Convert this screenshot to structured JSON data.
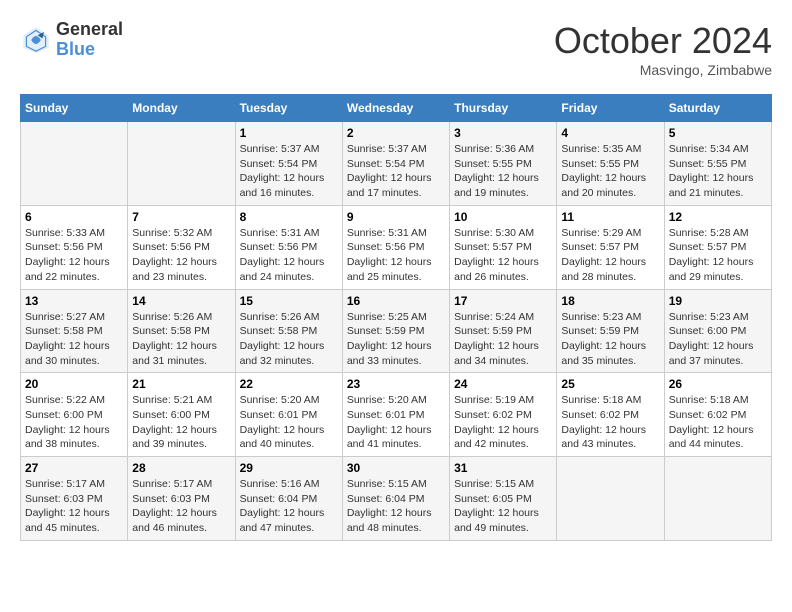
{
  "header": {
    "logo_line1": "General",
    "logo_line2": "Blue",
    "month": "October 2024",
    "location": "Masvingo, Zimbabwe"
  },
  "days_of_week": [
    "Sunday",
    "Monday",
    "Tuesday",
    "Wednesday",
    "Thursday",
    "Friday",
    "Saturday"
  ],
  "weeks": [
    [
      {
        "day": "",
        "empty": true
      },
      {
        "day": "",
        "empty": true
      },
      {
        "day": "1",
        "sunrise": "5:37 AM",
        "sunset": "5:54 PM",
        "daylight": "Daylight: 12 hours and 16 minutes."
      },
      {
        "day": "2",
        "sunrise": "5:37 AM",
        "sunset": "5:54 PM",
        "daylight": "Daylight: 12 hours and 17 minutes."
      },
      {
        "day": "3",
        "sunrise": "5:36 AM",
        "sunset": "5:55 PM",
        "daylight": "Daylight: 12 hours and 19 minutes."
      },
      {
        "day": "4",
        "sunrise": "5:35 AM",
        "sunset": "5:55 PM",
        "daylight": "Daylight: 12 hours and 20 minutes."
      },
      {
        "day": "5",
        "sunrise": "5:34 AM",
        "sunset": "5:55 PM",
        "daylight": "Daylight: 12 hours and 21 minutes."
      }
    ],
    [
      {
        "day": "6",
        "sunrise": "5:33 AM",
        "sunset": "5:56 PM",
        "daylight": "Daylight: 12 hours and 22 minutes."
      },
      {
        "day": "7",
        "sunrise": "5:32 AM",
        "sunset": "5:56 PM",
        "daylight": "Daylight: 12 hours and 23 minutes."
      },
      {
        "day": "8",
        "sunrise": "5:31 AM",
        "sunset": "5:56 PM",
        "daylight": "Daylight: 12 hours and 24 minutes."
      },
      {
        "day": "9",
        "sunrise": "5:31 AM",
        "sunset": "5:56 PM",
        "daylight": "Daylight: 12 hours and 25 minutes."
      },
      {
        "day": "10",
        "sunrise": "5:30 AM",
        "sunset": "5:57 PM",
        "daylight": "Daylight: 12 hours and 26 minutes."
      },
      {
        "day": "11",
        "sunrise": "5:29 AM",
        "sunset": "5:57 PM",
        "daylight": "Daylight: 12 hours and 28 minutes."
      },
      {
        "day": "12",
        "sunrise": "5:28 AM",
        "sunset": "5:57 PM",
        "daylight": "Daylight: 12 hours and 29 minutes."
      }
    ],
    [
      {
        "day": "13",
        "sunrise": "5:27 AM",
        "sunset": "5:58 PM",
        "daylight": "Daylight: 12 hours and 30 minutes."
      },
      {
        "day": "14",
        "sunrise": "5:26 AM",
        "sunset": "5:58 PM",
        "daylight": "Daylight: 12 hours and 31 minutes."
      },
      {
        "day": "15",
        "sunrise": "5:26 AM",
        "sunset": "5:58 PM",
        "daylight": "Daylight: 12 hours and 32 minutes."
      },
      {
        "day": "16",
        "sunrise": "5:25 AM",
        "sunset": "5:59 PM",
        "daylight": "Daylight: 12 hours and 33 minutes."
      },
      {
        "day": "17",
        "sunrise": "5:24 AM",
        "sunset": "5:59 PM",
        "daylight": "Daylight: 12 hours and 34 minutes."
      },
      {
        "day": "18",
        "sunrise": "5:23 AM",
        "sunset": "5:59 PM",
        "daylight": "Daylight: 12 hours and 35 minutes."
      },
      {
        "day": "19",
        "sunrise": "5:23 AM",
        "sunset": "6:00 PM",
        "daylight": "Daylight: 12 hours and 37 minutes."
      }
    ],
    [
      {
        "day": "20",
        "sunrise": "5:22 AM",
        "sunset": "6:00 PM",
        "daylight": "Daylight: 12 hours and 38 minutes."
      },
      {
        "day": "21",
        "sunrise": "5:21 AM",
        "sunset": "6:00 PM",
        "daylight": "Daylight: 12 hours and 39 minutes."
      },
      {
        "day": "22",
        "sunrise": "5:20 AM",
        "sunset": "6:01 PM",
        "daylight": "Daylight: 12 hours and 40 minutes."
      },
      {
        "day": "23",
        "sunrise": "5:20 AM",
        "sunset": "6:01 PM",
        "daylight": "Daylight: 12 hours and 41 minutes."
      },
      {
        "day": "24",
        "sunrise": "5:19 AM",
        "sunset": "6:02 PM",
        "daylight": "Daylight: 12 hours and 42 minutes."
      },
      {
        "day": "25",
        "sunrise": "5:18 AM",
        "sunset": "6:02 PM",
        "daylight": "Daylight: 12 hours and 43 minutes."
      },
      {
        "day": "26",
        "sunrise": "5:18 AM",
        "sunset": "6:02 PM",
        "daylight": "Daylight: 12 hours and 44 minutes."
      }
    ],
    [
      {
        "day": "27",
        "sunrise": "5:17 AM",
        "sunset": "6:03 PM",
        "daylight": "Daylight: 12 hours and 45 minutes."
      },
      {
        "day": "28",
        "sunrise": "5:17 AM",
        "sunset": "6:03 PM",
        "daylight": "Daylight: 12 hours and 46 minutes."
      },
      {
        "day": "29",
        "sunrise": "5:16 AM",
        "sunset": "6:04 PM",
        "daylight": "Daylight: 12 hours and 47 minutes."
      },
      {
        "day": "30",
        "sunrise": "5:15 AM",
        "sunset": "6:04 PM",
        "daylight": "Daylight: 12 hours and 48 minutes."
      },
      {
        "day": "31",
        "sunrise": "5:15 AM",
        "sunset": "6:05 PM",
        "daylight": "Daylight: 12 hours and 49 minutes."
      },
      {
        "day": "",
        "empty": true
      },
      {
        "day": "",
        "empty": true
      }
    ]
  ],
  "labels": {
    "sunrise_prefix": "Sunrise: ",
    "sunset_prefix": "Sunset: ",
    "daylight_label": "Daylight hours"
  }
}
